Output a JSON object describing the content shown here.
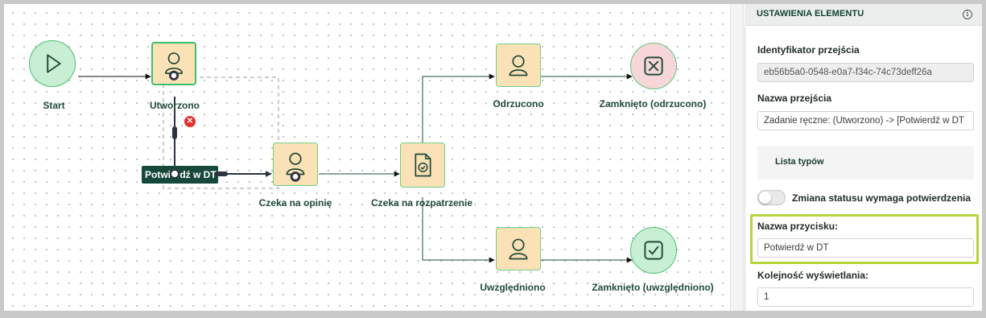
{
  "canvas": {
    "nodes": {
      "start": "Start",
      "created": "Utworzono",
      "rejected": "Odrzucono",
      "closed_rejected": "Zamknięto (odrzucono)",
      "awaiting_opinion": "Czeka na opinię",
      "awaiting_review": "Czeka na rozpatrzenie",
      "accepted": "Uwzględniono",
      "closed_accepted": "Zamknięto (uwzględniono)"
    },
    "edit_label": "Potwierdź w DT",
    "icons": {
      "start": "play-icon",
      "task": "user-icon",
      "gateway": "document-check-icon",
      "end_rejected": "x-box-icon",
      "end_accepted": "check-box-icon",
      "error": "error-x-icon"
    },
    "colors": {
      "task_fill": "#fbe1b6",
      "event_fill": "#c8efd4",
      "end_reject_fill": "#f7d6d8",
      "label_bg": "#17493a",
      "highlight": "#b5d53a"
    }
  },
  "panel": {
    "title": "USTAWIENIA ELEMENTU",
    "info_icon": "info-icon",
    "transition_id_label": "Identyfikator przejścia",
    "transition_id_value": "eb56b5a0-0548-e0a7-f34c-74c73deff26a",
    "transition_name_label": "Nazwa przejścia",
    "transition_name_value": "Zadanie ręczne: (Utworzono) -> [Potwierdź w DT",
    "types_list_label": "Lista typów",
    "confirm_toggle_label": "Zmiana statusu wymaga potwierdzenia",
    "confirm_toggle_on": false,
    "button_name_label": "Nazwa przycisku:",
    "button_name_value": "Potwierdź w DT",
    "display_order_label": "Kolejność wyświetlania:",
    "display_order_value": "1"
  }
}
